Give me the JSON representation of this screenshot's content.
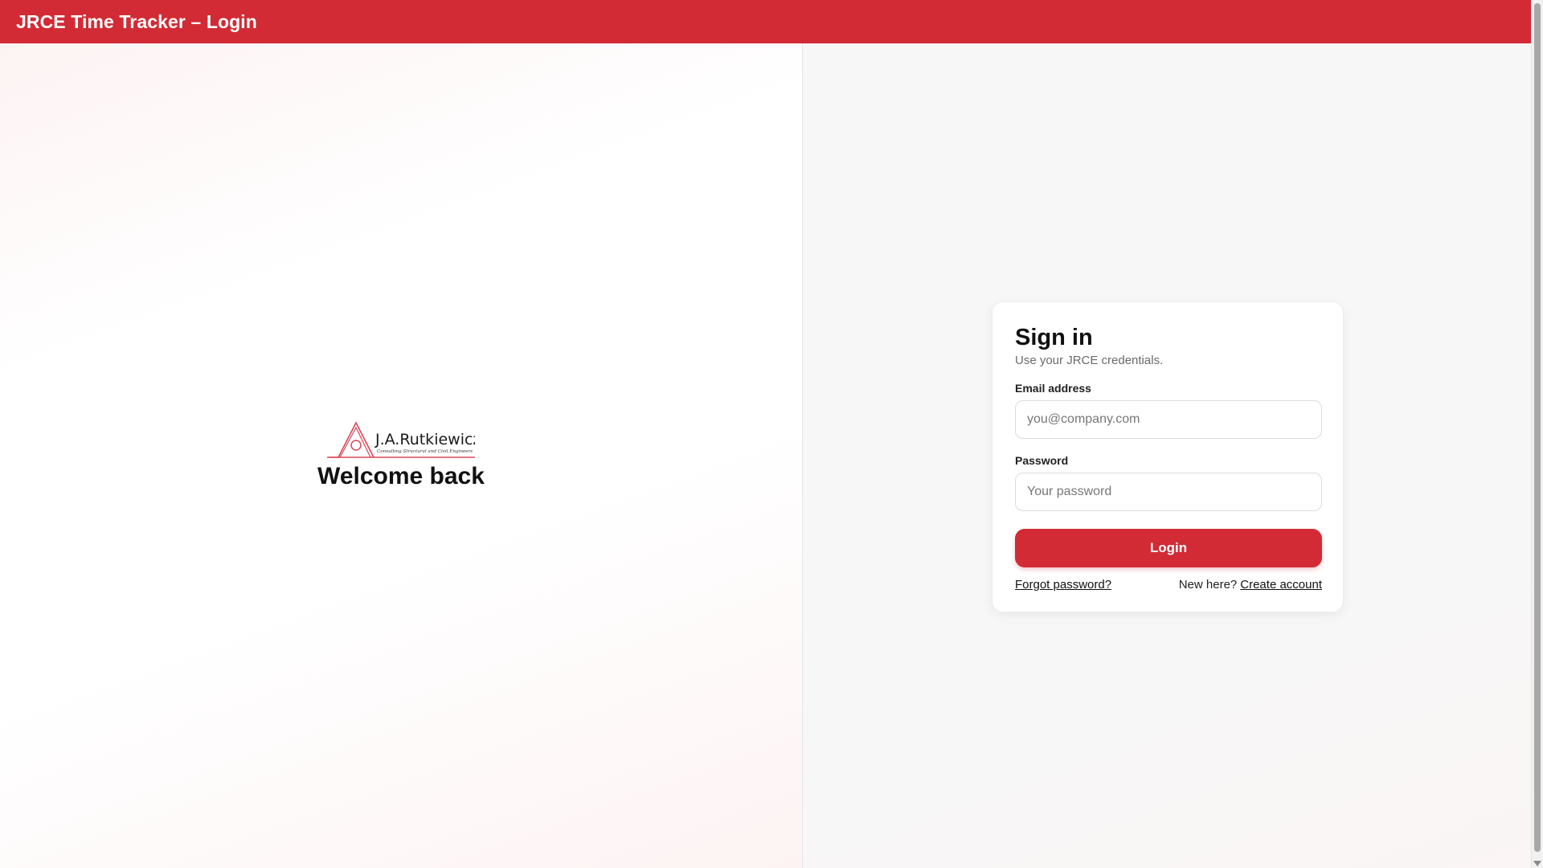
{
  "window": {
    "title": "JRCE Time Tracker – Login"
  },
  "brand": {
    "logo_name": "J.A.Rutkiewicz",
    "logo_tagline": "Consulting Structural and Civil Engineers",
    "welcome": "Welcome back"
  },
  "signin": {
    "title": "Sign in",
    "subtitle": "Use your JRCE credentials.",
    "email_label": "Email address",
    "email_placeholder": "you@company.com",
    "email_value": "",
    "password_label": "Password",
    "password_placeholder": "Your password",
    "password_value": "",
    "login_label": "Login",
    "forgot_label": "Forgot password?",
    "new_here_label": "New here?",
    "create_account_label": "Create account"
  },
  "colors": {
    "brand_red": "#d22b35",
    "card_bg": "#ffffff",
    "page_bg": "#f7f7f7"
  },
  "icons": {
    "logo": "jar-house-logo-icon",
    "scroll_down": "scroll-down-arrow-icon"
  }
}
